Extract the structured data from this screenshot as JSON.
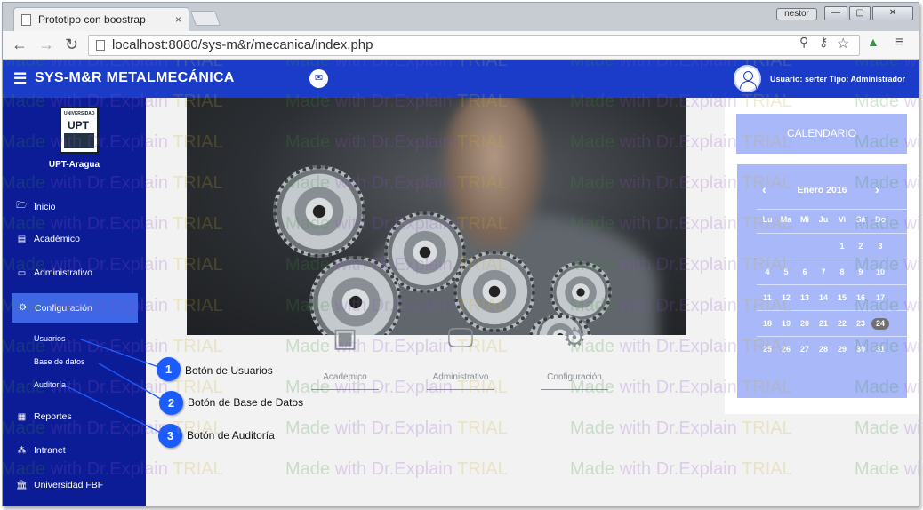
{
  "browser": {
    "tab_title": "Prototipo con boostrap",
    "tab_close": "×",
    "user_badge": "nestor",
    "window_controls": [
      "—",
      "▢",
      "✕"
    ],
    "url": "localhost:8080/sys-m&r/mecanica/index.php"
  },
  "app": {
    "brand": "SYS-M&R  METALMECÁNICA",
    "user_info": "Usuario: serter   Tipo: Administrador",
    "university": "UPT-Aragua",
    "logo_text": "UNIVERSIDAD",
    "logo_letters": "UPT"
  },
  "sidebar": {
    "items": [
      {
        "label": "Inicio",
        "icon": "folder-open-icon"
      },
      {
        "label": "Académico",
        "icon": "book-icon"
      },
      {
        "label": "Administrativo",
        "icon": "monitor-icon"
      },
      {
        "label": "Configuración",
        "icon": "gears-icon"
      },
      {
        "label": "Reportes",
        "icon": "file-icon"
      },
      {
        "label": "Intranet",
        "icon": "sitemap-icon"
      },
      {
        "label": "Universidad FBF",
        "icon": "university-icon"
      }
    ],
    "subitems": [
      "Usuarios",
      "Base de datos",
      "Auditoría"
    ]
  },
  "main": {
    "shortcuts": [
      {
        "label": "Academico",
        "icon": "wallet-icon"
      },
      {
        "label": "Administrativo",
        "icon": "monitor-icon"
      },
      {
        "label": "Configuración",
        "icon": "gear-icon"
      }
    ]
  },
  "calendar": {
    "title": "CALENDARIO",
    "month": "Enero 2016",
    "weekdays": [
      "Lu",
      "Ma",
      "Mi",
      "Ju",
      "Vi",
      "Sá",
      "Do"
    ],
    "weeks": [
      [
        "",
        "",
        "",
        "",
        "1",
        "2",
        "3"
      ],
      [
        "4",
        "5",
        "6",
        "7",
        "8",
        "9",
        "10"
      ],
      [
        "11",
        "12",
        "13",
        "14",
        "15",
        "16",
        "17"
      ],
      [
        "18",
        "19",
        "20",
        "21",
        "22",
        "23",
        "24"
      ],
      [
        "25",
        "26",
        "27",
        "28",
        "29",
        "30",
        "31"
      ]
    ],
    "today": "24"
  },
  "callouts": [
    {
      "num": "1",
      "text": "Botón de Usuarios"
    },
    {
      "num": "2",
      "text": "Botón de Base de Datos"
    },
    {
      "num": "3",
      "text": "Botón de Auditoría"
    }
  ],
  "watermark": {
    "part1": "Made",
    "part2": " with Dr.Explain ",
    "part3": "TRIAL"
  },
  "colors": {
    "navbar": "#1a3cc8",
    "sidebar": "#0c1c96",
    "active_item": "#3f66e4",
    "calendar": "#a9b8f8",
    "callout": "#1b5cff"
  }
}
